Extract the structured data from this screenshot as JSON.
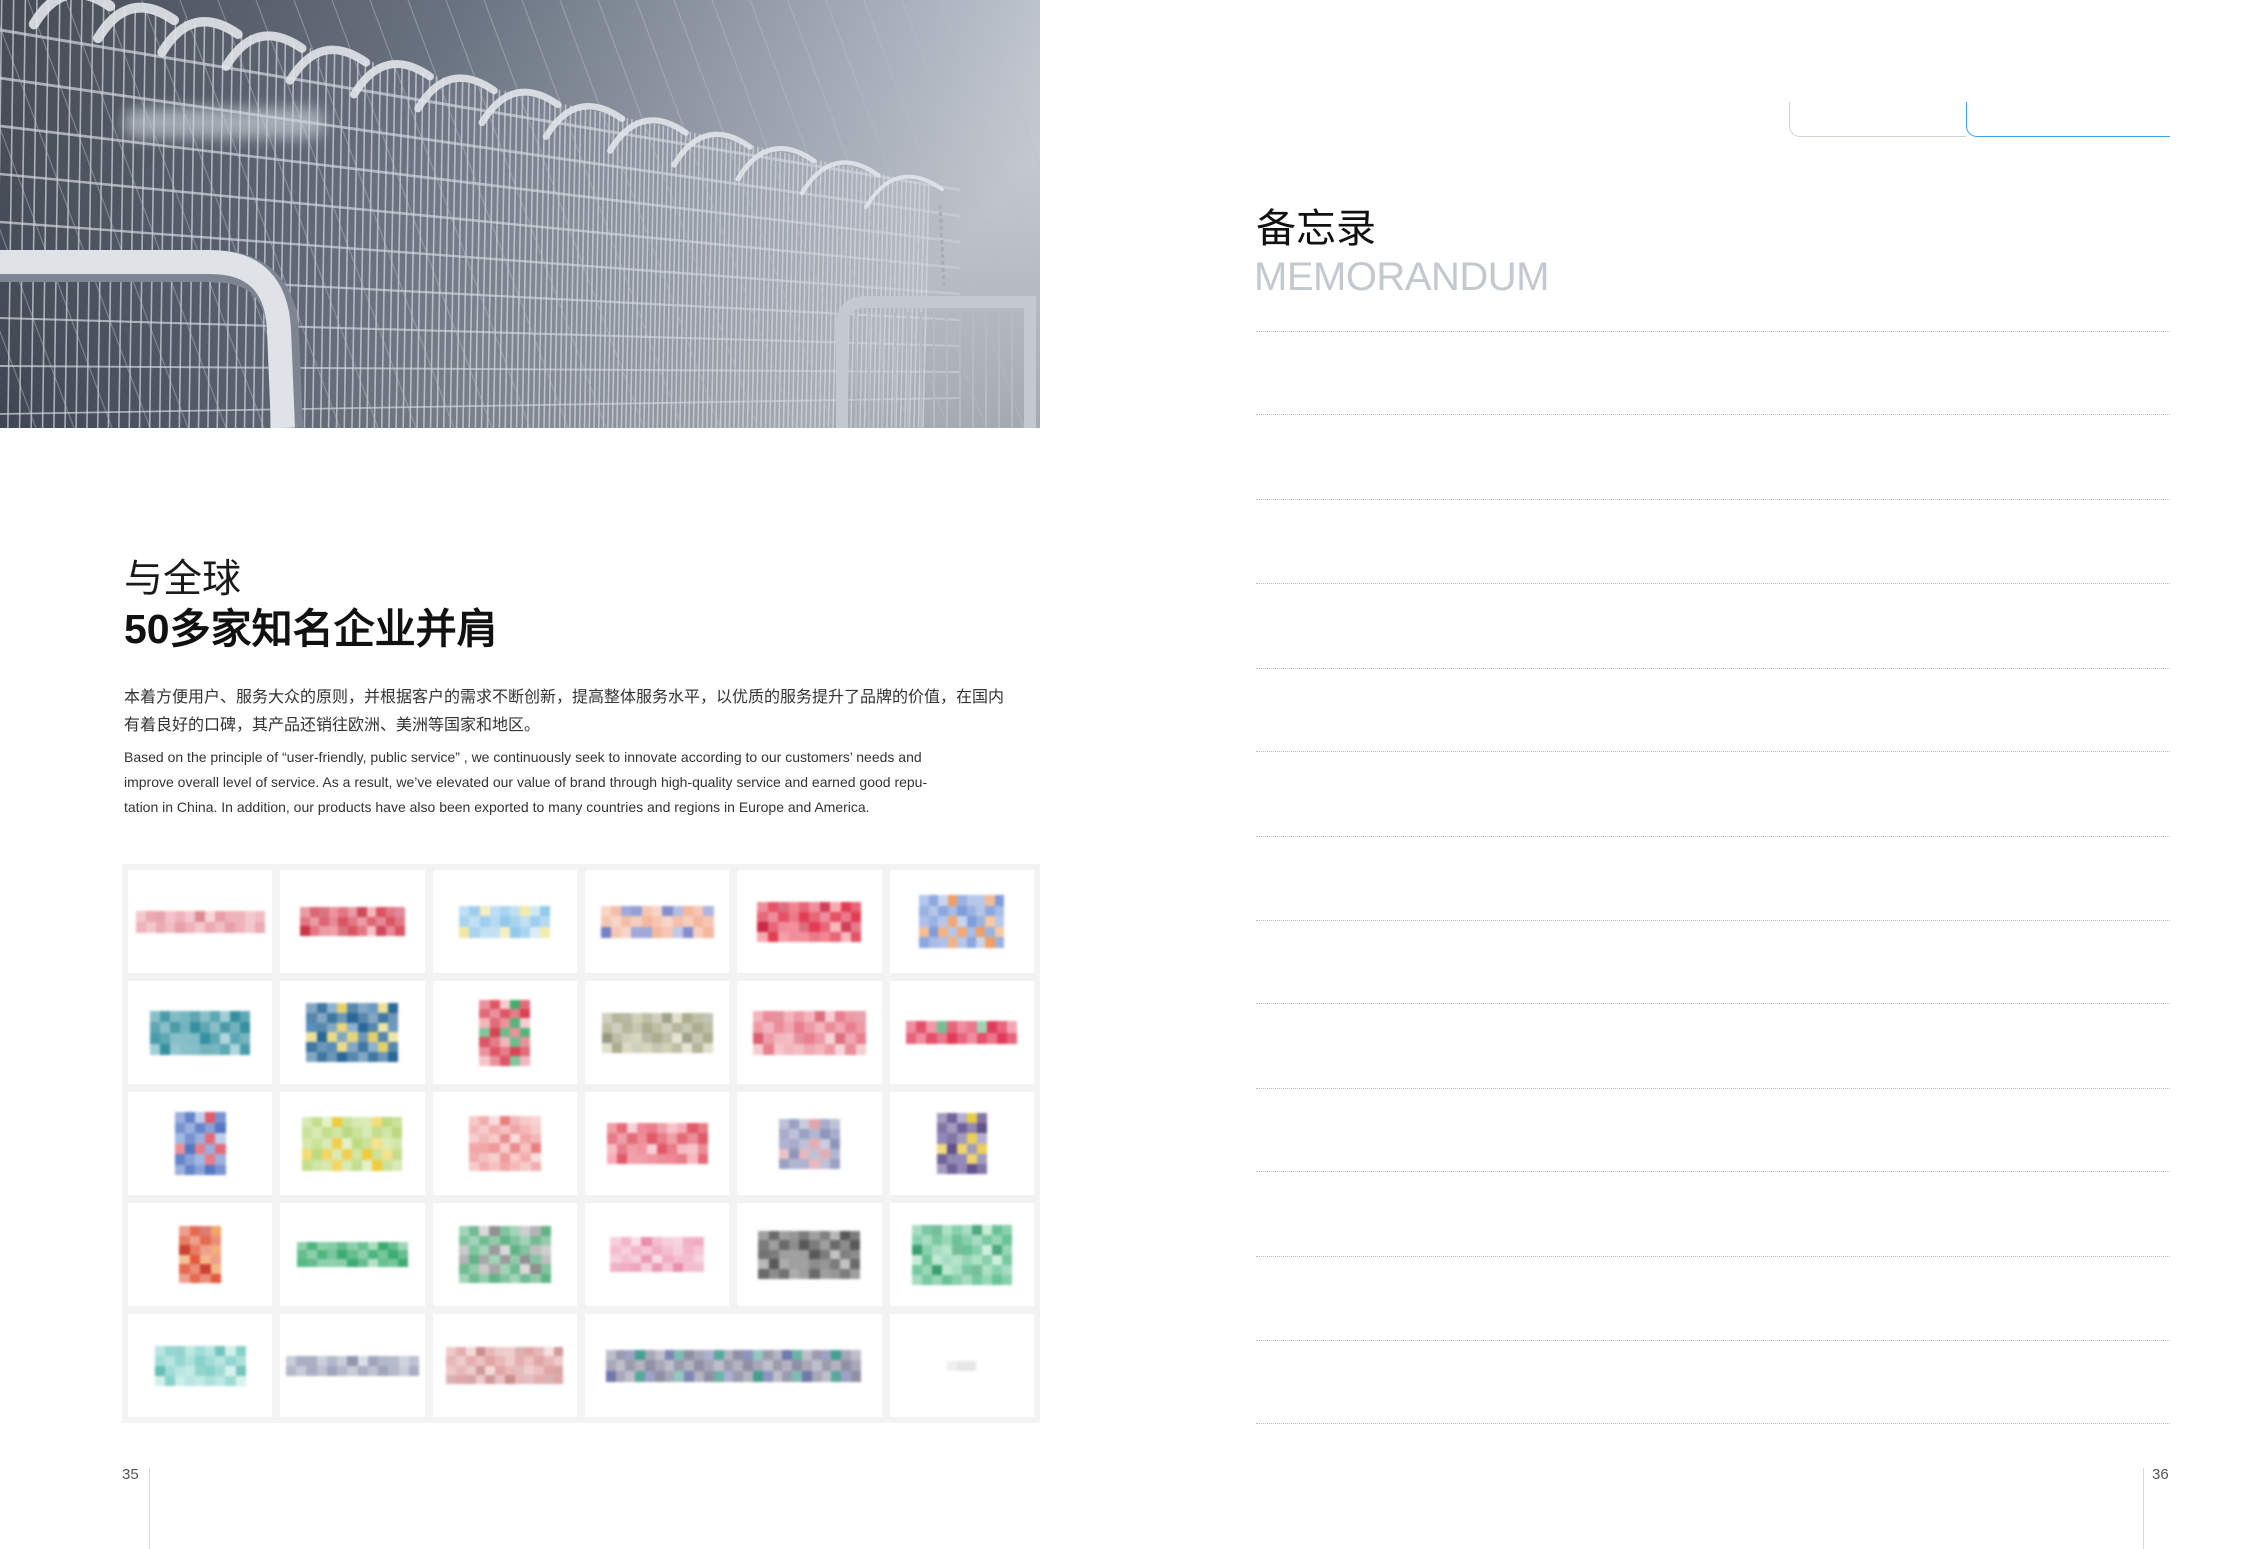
{
  "left_page": {
    "heading_line1": "与全球",
    "heading_line2": "50多家知名企业并肩",
    "intro_cn_lines": [
      "本着方便用户、服务大众的原则，并根据客户的需求不断创新，提高整体服务水平，以优质的服务提升了品牌的价值，在国内",
      "有着良好的口碑，其产品还销往欧洲、美洲等国家和地区。"
    ],
    "intro_en_lines": [
      "Based on the principle of “user-friendly, public service” , we continuously seek to innovate according to our customers’ needs and",
      "improve overall level of service. As a result, we’ve elevated our value of brand through high-quality service and earned good repu-",
      "tation in China. In addition, our products have also been exported to many countries and regions in Europe and America."
    ],
    "page_number": "35"
  },
  "right_page": {
    "title_cn": "备忘录",
    "title_en": "MEMORANDUM",
    "page_number": "36"
  },
  "colors": {
    "accent_tab": "#3f9fe0",
    "tab_gray": "#ccd3da",
    "memo_subtitle": "#c3c9cf",
    "rule": "#bcbcbc",
    "logo_grid_background": "#f3f3f3"
  },
  "logos": [
    {
      "colors": [
        "#e89aa3",
        "#f2c0c6",
        "#d97782"
      ]
    },
    {
      "colors": [
        "#d84a5a",
        "#ee8d98",
        "#c42a3f"
      ]
    },
    {
      "colors": [
        "#8cc6ea",
        "#b9dcf3",
        "#f1e79f"
      ]
    },
    {
      "colors": [
        "#f3b39a",
        "#8f9ad4",
        "#6f79c5"
      ]
    },
    {
      "colors": [
        "#e0324a",
        "#f27d88",
        "#c81e3a"
      ]
    },
    {
      "colors": [
        "#7898d8",
        "#f09a5a",
        "#aabde8"
      ]
    },
    {
      "colors": [
        "#2a8a9a",
        "#6fb3bf",
        "#3f98a6"
      ]
    },
    {
      "colors": [
        "#1d5f92",
        "#e4cf62",
        "#4f88b8"
      ]
    },
    {
      "colors": [
        "#d8384a",
        "#3aa862",
        "#f2b0b8"
      ]
    },
    {
      "colors": [
        "#a8a888",
        "#cfcfb2",
        "#8f9478"
      ]
    },
    {
      "colors": [
        "#e87888",
        "#f3b0b8",
        "#d85668"
      ]
    },
    {
      "colors": [
        "#e03050",
        "#6cbc8c",
        "#ea5f78"
      ]
    },
    {
      "colors": [
        "#4a70c0",
        "#e05060",
        "#9cb4e2"
      ]
    },
    {
      "colors": [
        "#b8d878",
        "#f0c830",
        "#d4e8a8"
      ]
    },
    {
      "colors": [
        "#f0a0a0",
        "#e87878",
        "#f6cccc"
      ]
    },
    {
      "colors": [
        "#e05060",
        "#f08090",
        "#f6b8c0"
      ]
    },
    {
      "colors": [
        "#8890b8",
        "#e0a0a8",
        "#aab0cc"
      ]
    },
    {
      "colors": [
        "#584888",
        "#e8c838",
        "#8c82b8"
      ]
    },
    {
      "colors": [
        "#e05030",
        "#f0a060",
        "#c83828"
      ]
    },
    {
      "colors": [
        "#30a868",
        "#7cc9a0",
        "#4cb67c"
      ]
    },
    {
      "colors": [
        "#58b080",
        "#8a8a8a",
        "#c6c6c6"
      ]
    },
    {
      "colors": [
        "#f0a8c0",
        "#e888a8",
        "#f6ccd8"
      ]
    },
    {
      "colors": [
        "#505050",
        "#909090",
        "#6a6a6a"
      ]
    },
    {
      "colors": [
        "#60c090",
        "#a8e0c0",
        "#2f9a66"
      ]
    },
    {
      "colors": [
        "#80d0c8",
        "#b8e8e0",
        "#5cbcb2"
      ]
    },
    {
      "colors": [
        "#9aa0b8",
        "#c8ccd8",
        "#7c84a0"
      ]
    },
    {
      "colors": [
        "#e0a0a0",
        "#c88888",
        "#eec4c4"
      ]
    },
    {
      "colors": [
        "#8a8aa0",
        "#3a9a8a",
        "#6870a8"
      ]
    },
    {
      "colors": [
        "#e2e2e2",
        "#ececec",
        "#d8d8d8"
      ]
    }
  ]
}
